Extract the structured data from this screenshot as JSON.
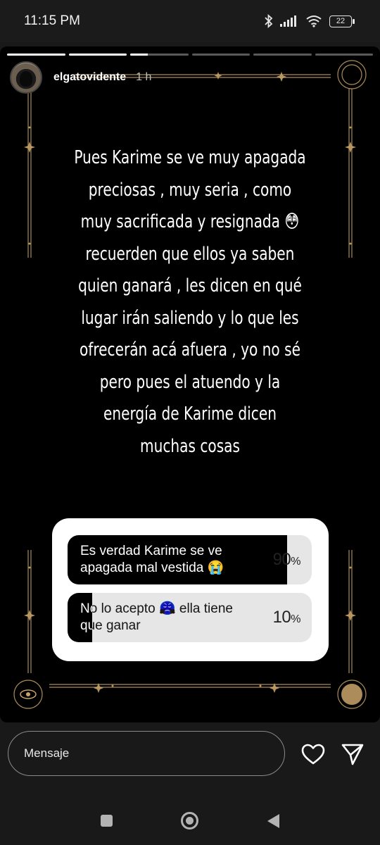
{
  "status_bar": {
    "time": "11:15 PM",
    "battery": "22",
    "icons": [
      "bluetooth-icon",
      "signal-icon",
      "wifi-icon",
      "battery-icon"
    ]
  },
  "story": {
    "segments_total": 6,
    "segments_complete": 2,
    "current_segment_progress": 0.3,
    "username": "elgatovidente",
    "time_ago": "1 h",
    "text": "Pues Karime se ve muy apagada\npreciosas , muy seria , como\nmuy sacrificada y resignada 😳\nrecuerden que ellos ya saben\nquien ganará , les dicen en qué\nlugar irán saliendo y lo que les\nofrecerán acá afuera , yo no sé\npero pues el atuendo y la\nenergía de Karime dicen\nmuchas cosas",
    "accent_color": "#c9a46a"
  },
  "poll": {
    "options": [
      {
        "label": "Es verdad Karime se ve apagada mal vestida 😭",
        "percent": "90",
        "share": 0.9
      },
      {
        "label": "No lo acepto 😤 ella tiene que ganar",
        "percent": "10",
        "share": 0.1
      }
    ]
  },
  "bottom": {
    "message_placeholder": "Mensaje"
  }
}
